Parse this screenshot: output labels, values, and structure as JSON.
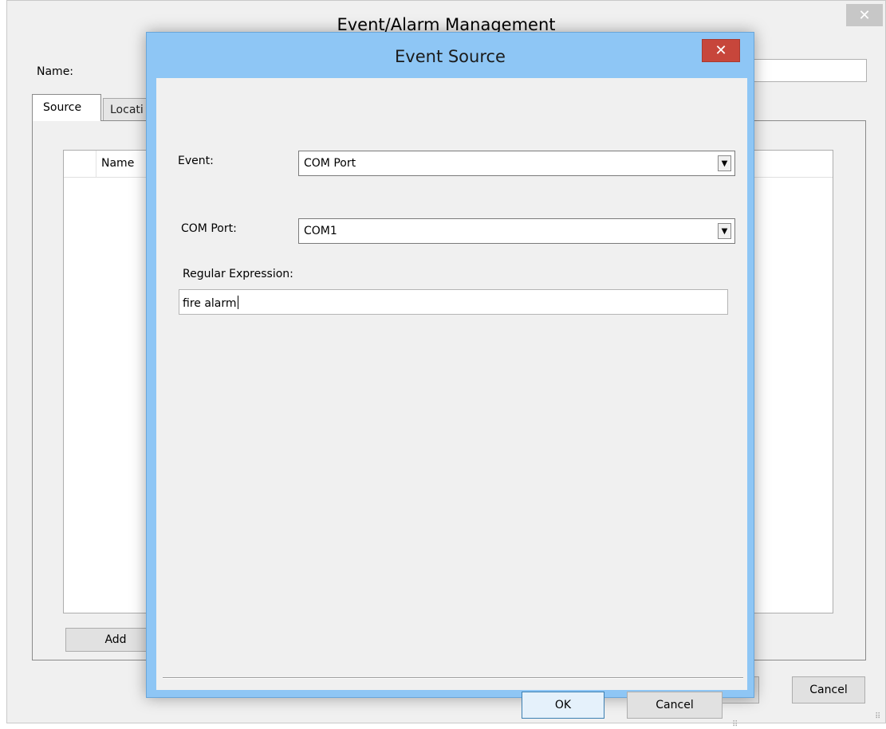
{
  "background_window": {
    "title": "Event/Alarm Management",
    "close_glyph": "✕",
    "name_label": "Name:",
    "name_value": "",
    "tabs": [
      {
        "label": "Source"
      },
      {
        "label": "Locati"
      }
    ],
    "list": {
      "columns": [
        "Name"
      ]
    },
    "add_label": "Add",
    "ok_label": "OK",
    "cancel_label": "Cancel"
  },
  "dialog": {
    "title": "Event Source",
    "close_glyph": "✕",
    "event_label": "Event:",
    "event_value": "COM Port",
    "comport_label": "COM Port:",
    "comport_value": "COM1",
    "regex_label": "Regular Expression:",
    "regex_value": "fire alarm",
    "ok_label": "OK",
    "cancel_label": "Cancel",
    "dropdown_glyph": "▼",
    "grip_glyph": "⠿"
  },
  "colors": {
    "dialog_frame": "#8ec6f5",
    "close_button": "#c7463b",
    "window_bg": "#f0f0f0"
  }
}
